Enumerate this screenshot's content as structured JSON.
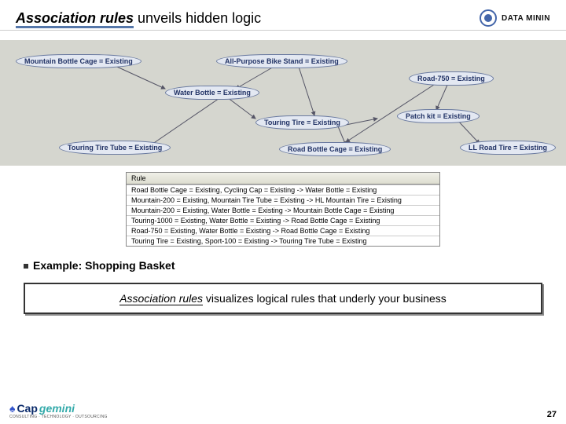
{
  "header": {
    "title_bold": "Association rules",
    "title_rest": " unveils hidden logic",
    "brand": "DATA MININ"
  },
  "nodes": {
    "mountain_bottle_cage": "Mountain Bottle Cage = Existing",
    "water_bottle": "Water Bottle = Existing",
    "all_purpose": "All-Purpose Bike Stand = Existing",
    "touring_tire": "Touring Tire = Existing",
    "touring_tire_tube": "Touring Tire Tube = Existing",
    "road_bottle_cage": "Road Bottle Cage = Existing",
    "road_750": "Road-750 = Existing",
    "patch_kit": "Patch kit = Existing",
    "ll_road_tire": "LL Road Tire = Existing"
  },
  "rules_header": "Rule",
  "rules": [
    "Road Bottle Cage = Existing, Cycling Cap = Existing -> Water Bottle = Existing",
    "Mountain-200 = Existing, Mountain Tire Tube = Existing -> HL Mountain Tire = Existing",
    "Mountain-200 = Existing, Water Bottle = Existing -> Mountain Bottle Cage = Existing",
    "Touring-1000 = Existing, Water Bottle = Existing -> Road Bottle Cage = Existing",
    "Road-750 = Existing, Water Bottle = Existing -> Road Bottle Cage = Existing",
    "Touring Tire = Existing, Sport-100 = Existing -> Touring Tire Tube = Existing"
  ],
  "example": "Example: Shopping Basket",
  "callout_i": "Association rules",
  "callout_n": " visualizes logical rules that underly your business",
  "footer": {
    "logo_cap": "Cap",
    "logo_gem": "gemini",
    "tagline": "CONSULTING · TECHNOLOGY · OUTSOURCING",
    "page": "27"
  }
}
